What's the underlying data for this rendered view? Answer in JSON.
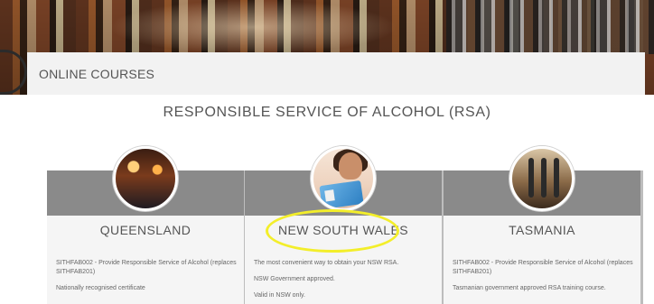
{
  "section": {
    "label": "ONLINE COURSES"
  },
  "main": {
    "title": "RESPONSIBLE SERVICE OF ALCOHOL (RSA)"
  },
  "cards": [
    {
      "name": "QUEENSLAND",
      "lines": [
        "SITHFAB002 - Provide Responsible Service of Alcohol (replaces SITHFAB201)",
        "Nationally recognised certificate"
      ]
    },
    {
      "name": "NEW SOUTH WALES",
      "lines": [
        "The most convenient way to obtain your NSW RSA.",
        "NSW Government approved.",
        "Valid in NSW only."
      ]
    },
    {
      "name": "TASMANIA",
      "lines": [
        "SITHFAB002 - Provide Responsible Service of Alcohol (replaces SITHFAB201)",
        "Tasmanian government approved RSA training course."
      ]
    }
  ],
  "colors": {
    "highlight": "#f3ee2a",
    "card_band": "#8a8a8a",
    "card_bg": "#f5f5f5",
    "section_bar": "#f2f2f2"
  },
  "icons": [
    "bar-photo-icon",
    "licence-photo-icon",
    "beer-taps-photo-icon"
  ]
}
